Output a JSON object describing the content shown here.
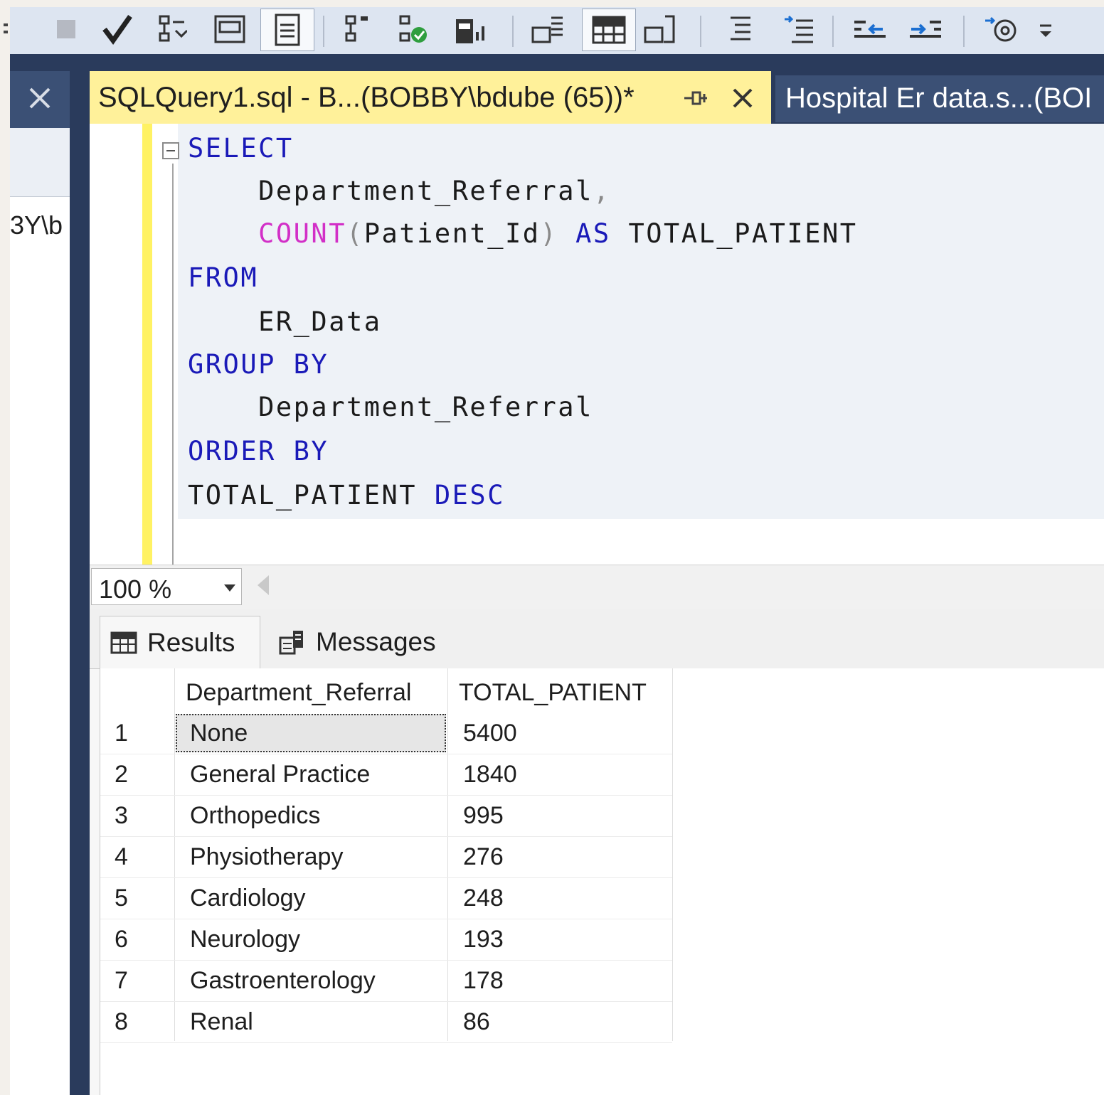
{
  "left_panel": {
    "partial_text": "3Y\\b"
  },
  "tabs": {
    "active_title": "SQLQuery1.sql - B...(BOBBY\\bdube (65))*",
    "inactive_title": "Hospital Er data.s...(BOI"
  },
  "editor": {
    "lines": [
      {
        "parts": [
          {
            "t": "SELECT",
            "c": "kw"
          }
        ]
      },
      {
        "parts": [
          {
            "t": "    Department_Referral",
            "c": ""
          },
          {
            "t": ",",
            "c": "gray"
          }
        ]
      },
      {
        "parts": [
          {
            "t": "    ",
            "c": ""
          },
          {
            "t": "COUNT",
            "c": "fn"
          },
          {
            "t": "(",
            "c": "gray"
          },
          {
            "t": "Patient_Id",
            "c": ""
          },
          {
            "t": ")",
            "c": "gray"
          },
          {
            "t": " ",
            "c": ""
          },
          {
            "t": "AS",
            "c": "kw"
          },
          {
            "t": " TOTAL_PATIENT",
            "c": ""
          }
        ]
      },
      {
        "parts": [
          {
            "t": "FROM",
            "c": "kw"
          }
        ]
      },
      {
        "parts": [
          {
            "t": "    ER_Data",
            "c": ""
          }
        ]
      },
      {
        "parts": [
          {
            "t": "GROUP BY",
            "c": "kw"
          }
        ]
      },
      {
        "parts": [
          {
            "t": "    Department_Referral",
            "c": ""
          }
        ]
      },
      {
        "parts": [
          {
            "t": "ORDER BY",
            "c": "kw"
          }
        ]
      },
      {
        "parts": [
          {
            "t": "TOTAL_PATIENT ",
            "c": ""
          },
          {
            "t": "DESC",
            "c": "kw"
          }
        ]
      }
    ]
  },
  "zoom": {
    "value": "100 %"
  },
  "results": {
    "tabs": {
      "results_label": "Results",
      "messages_label": "Messages"
    },
    "columns": [
      "Department_Referral",
      "TOTAL_PATIENT"
    ],
    "rows": [
      {
        "num": "1",
        "dept": "None",
        "total": "5400"
      },
      {
        "num": "2",
        "dept": "General Practice",
        "total": "1840"
      },
      {
        "num": "3",
        "dept": "Orthopedics",
        "total": "995"
      },
      {
        "num": "4",
        "dept": "Physiotherapy",
        "total": "276"
      },
      {
        "num": "5",
        "dept": "Cardiology",
        "total": "248"
      },
      {
        "num": "6",
        "dept": "Neurology",
        "total": "193"
      },
      {
        "num": "7",
        "dept": "Gastroenterology",
        "total": "178"
      },
      {
        "num": "8",
        "dept": "Renal",
        "total": "86"
      }
    ]
  },
  "colors": {
    "frame": "#2a3b5c",
    "active_tab": "#fff19a",
    "keyword": "#1a1ab8",
    "function": "#d22fc7"
  }
}
